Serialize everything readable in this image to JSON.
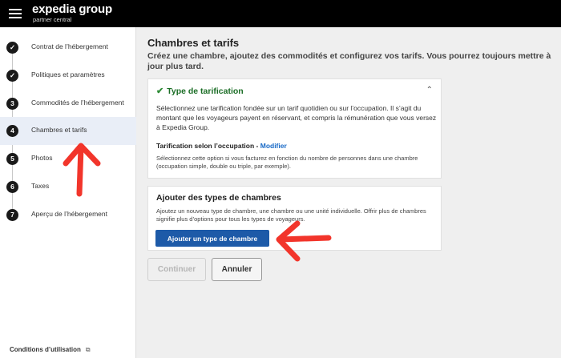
{
  "header": {
    "brand": "expedia group",
    "sub": "partner central"
  },
  "sidebar": {
    "steps": [
      {
        "num": "✓",
        "label": "Contrat de l’hébergement"
      },
      {
        "num": "✓",
        "label": "Politiques et paramètres"
      },
      {
        "num": "3",
        "label": "Commodités de l’hébergement"
      },
      {
        "num": "4",
        "label": "Chambres et tarifs"
      },
      {
        "num": "5",
        "label": "Photos"
      },
      {
        "num": "6",
        "label": "Taxes"
      },
      {
        "num": "7",
        "label": "Aperçu de l’hébergement"
      }
    ],
    "footer_link": "Conditions d’utilisation",
    "footer_icon": "external-link-icon"
  },
  "main": {
    "title": "Chambres et tarifs",
    "description": "Créez une chambre, ajoutez des commodités et configurez vos tarifs. Vous pourrez toujours mettre à jour plus tard.",
    "pricing_card": {
      "title": "Type de tarification",
      "description": "Sélectionnez une tarification fondée sur un tarif quotidien ou sur l’occupation. Il s’agit du montant que les voyageurs payent en réservant, et compris la rémunération que vous versez à Expedia Group.",
      "selection_label": "Tarification selon l’occupation -",
      "modify_link": "Modifier",
      "selection_desc": "Sélectionnez cette option si vous facturez en fonction du nombre de personnes dans une chambre (occupation simple, double ou triple, par exemple)."
    },
    "rooms_card": {
      "title": "Ajouter des types de chambres",
      "description": "Ajoutez un nouveau type de chambre, une chambre ou une unité individuelle. Offrir plus de chambres signifie plus d’options pour tous les types de voyageurs.",
      "add_button": "Ajouter un type de chambre"
    },
    "continue_button": "Continuer",
    "cancel_button": "Annuler"
  },
  "colors": {
    "header_bg": "#000000",
    "accent_blue": "#1d5aa8",
    "success_green": "#2e8b36",
    "annotation_red": "#f2352b"
  }
}
